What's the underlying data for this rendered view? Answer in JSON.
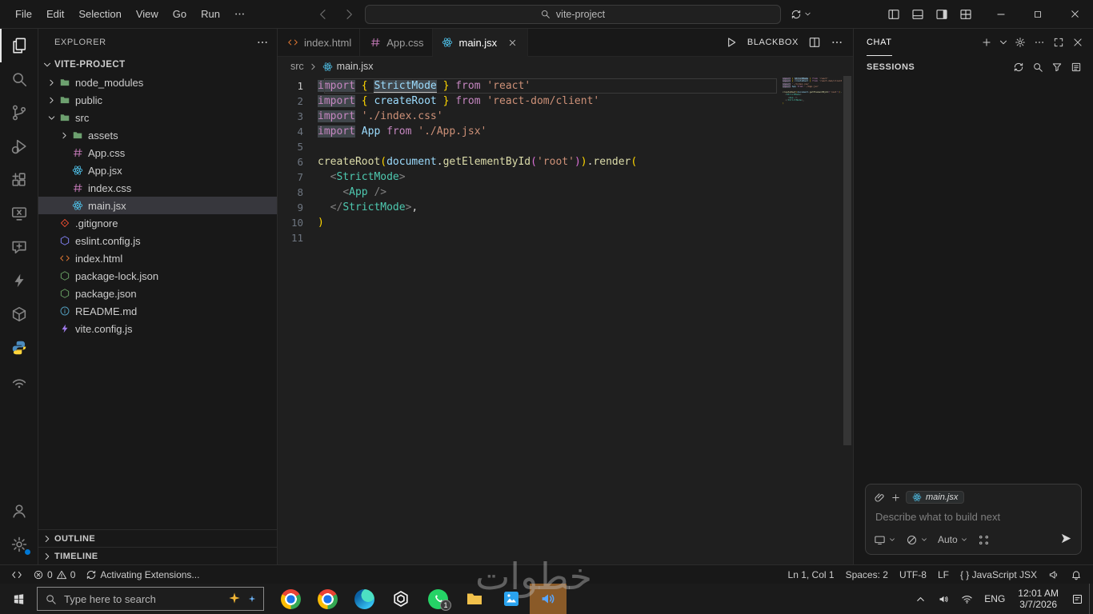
{
  "titlebar": {
    "menus": [
      "File",
      "Edit",
      "Selection",
      "View",
      "Go",
      "Run"
    ],
    "search_value": "vite-project"
  },
  "activity_bar": {
    "top": [
      "files",
      "search",
      "git-branch",
      "debug",
      "extensions",
      "remote-x",
      "chat-plus",
      "bolt",
      "cube",
      "python",
      "signal"
    ],
    "active": "files",
    "bottom": [
      "account",
      "gear"
    ]
  },
  "sidebar": {
    "header": "EXPLORER",
    "project": "VITE-PROJECT",
    "tree": [
      {
        "label": "node_modules",
        "kind": "folder",
        "level": 0
      },
      {
        "label": "public",
        "kind": "folder",
        "level": 0
      },
      {
        "label": "src",
        "kind": "folder",
        "level": 0,
        "expanded": true
      },
      {
        "label": "assets",
        "kind": "folder",
        "level": 1
      },
      {
        "label": "App.css",
        "kind": "css",
        "level": 1
      },
      {
        "label": "App.jsx",
        "kind": "react",
        "level": 1
      },
      {
        "label": "index.css",
        "kind": "css",
        "level": 1
      },
      {
        "label": "main.jsx",
        "kind": "react",
        "level": 1,
        "selected": true
      },
      {
        "label": ".gitignore",
        "kind": "git",
        "level": 0
      },
      {
        "label": "eslint.config.js",
        "kind": "eslint",
        "level": 0
      },
      {
        "label": "index.html",
        "kind": "html",
        "level": 0
      },
      {
        "label": "package-lock.json",
        "kind": "npm",
        "level": 0
      },
      {
        "label": "package.json",
        "kind": "npm",
        "level": 0
      },
      {
        "label": "README.md",
        "kind": "info",
        "level": 0
      },
      {
        "label": "vite.config.js",
        "kind": "vite",
        "level": 0
      }
    ],
    "outline_label": "OUTLINE",
    "timeline_label": "TIMELINE"
  },
  "editor": {
    "tabs": [
      {
        "label": "index.html",
        "kind": "html",
        "active": false
      },
      {
        "label": "App.css",
        "kind": "css",
        "active": false
      },
      {
        "label": "main.jsx",
        "kind": "react",
        "active": true
      }
    ],
    "actions": {
      "brand": "BLACKBOX"
    },
    "breadcrumb": {
      "folder": "src",
      "file": "main.jsx"
    },
    "code_lines": [
      {
        "n": 1,
        "active": true,
        "tokens": [
          {
            "t": "import",
            "c": "kw hl"
          },
          {
            "t": " ",
            "c": "pn"
          },
          {
            "t": "{",
            "c": "b1"
          },
          {
            "t": " ",
            "c": "pn"
          },
          {
            "t": "StrictMode",
            "c": "id hl u"
          },
          {
            "t": " ",
            "c": "pn"
          },
          {
            "t": "}",
            "c": "b1"
          },
          {
            "t": " ",
            "c": "pn"
          },
          {
            "t": "from",
            "c": "kw"
          },
          {
            "t": " ",
            "c": "pn"
          },
          {
            "t": "'react'",
            "c": "str"
          }
        ]
      },
      {
        "n": 2,
        "tokens": [
          {
            "t": "import",
            "c": "kw hl"
          },
          {
            "t": " ",
            "c": "pn"
          },
          {
            "t": "{",
            "c": "b1"
          },
          {
            "t": " ",
            "c": "pn"
          },
          {
            "t": "createRoot",
            "c": "id"
          },
          {
            "t": " ",
            "c": "pn"
          },
          {
            "t": "}",
            "c": "b1"
          },
          {
            "t": " ",
            "c": "pn"
          },
          {
            "t": "from",
            "c": "kw"
          },
          {
            "t": " ",
            "c": "pn"
          },
          {
            "t": "'react-dom/client'",
            "c": "str"
          }
        ]
      },
      {
        "n": 3,
        "tokens": [
          {
            "t": "import",
            "c": "kw hl"
          },
          {
            "t": " ",
            "c": "pn"
          },
          {
            "t": "'./index.css'",
            "c": "str"
          }
        ]
      },
      {
        "n": 4,
        "tokens": [
          {
            "t": "import",
            "c": "kw hl"
          },
          {
            "t": " ",
            "c": "pn"
          },
          {
            "t": "App",
            "c": "id"
          },
          {
            "t": " ",
            "c": "pn"
          },
          {
            "t": "from",
            "c": "kw"
          },
          {
            "t": " ",
            "c": "pn"
          },
          {
            "t": "'./App.jsx'",
            "c": "str"
          }
        ]
      },
      {
        "n": 5,
        "tokens": []
      },
      {
        "n": 6,
        "tokens": [
          {
            "t": "createRoot",
            "c": "fn"
          },
          {
            "t": "(",
            "c": "b1"
          },
          {
            "t": "document",
            "c": "id"
          },
          {
            "t": ".",
            "c": "pn"
          },
          {
            "t": "getElementById",
            "c": "fn"
          },
          {
            "t": "(",
            "c": "b2"
          },
          {
            "t": "'root'",
            "c": "str"
          },
          {
            "t": ")",
            "c": "b2"
          },
          {
            "t": ")",
            "c": "b1"
          },
          {
            "t": ".",
            "c": "pn"
          },
          {
            "t": "render",
            "c": "fn"
          },
          {
            "t": "(",
            "c": "b1"
          }
        ]
      },
      {
        "n": 7,
        "tokens": [
          {
            "t": "  ",
            "c": "pn"
          },
          {
            "t": "<",
            "c": "tag"
          },
          {
            "t": "StrictMode",
            "c": "cmp"
          },
          {
            "t": ">",
            "c": "tag"
          }
        ]
      },
      {
        "n": 8,
        "tokens": [
          {
            "t": "    ",
            "c": "pn"
          },
          {
            "t": "<",
            "c": "tag"
          },
          {
            "t": "App",
            "c": "cmp"
          },
          {
            "t": " ",
            "c": "pn"
          },
          {
            "t": "/>",
            "c": "tag"
          }
        ]
      },
      {
        "n": 9,
        "tokens": [
          {
            "t": "  ",
            "c": "pn"
          },
          {
            "t": "</",
            "c": "tag"
          },
          {
            "t": "StrictMode",
            "c": "cmp"
          },
          {
            "t": ">",
            "c": "tag"
          },
          {
            "t": ",",
            "c": "pn"
          }
        ]
      },
      {
        "n": 10,
        "tokens": [
          {
            "t": ")",
            "c": "b1"
          }
        ]
      },
      {
        "n": 11,
        "tokens": []
      }
    ]
  },
  "chat": {
    "title": "CHAT",
    "sessions": "SESSIONS",
    "chip": "main.jsx",
    "placeholder": "Describe what to build next",
    "model": "Auto"
  },
  "status": {
    "errors": "0",
    "warnings": "0",
    "message": "Activating Extensions...",
    "cursor": "Ln 1, Col 1",
    "indent": "Spaces: 2",
    "encoding": "UTF-8",
    "eol": "LF",
    "lang": "{ } JavaScript JSX"
  },
  "taskbar": {
    "search_placeholder": "Type here to search",
    "apps": [
      "chrome",
      "chrome",
      "edge",
      "chatgpt",
      "whatsapp",
      "folder-app",
      "photos-app",
      "speaker-app"
    ],
    "active_app": "speaker-app",
    "whatsapp_badge": "1",
    "lang": "ENG",
    "time": "12:01 AM",
    "date": "3/7/2026"
  },
  "watermark": "خطوات"
}
